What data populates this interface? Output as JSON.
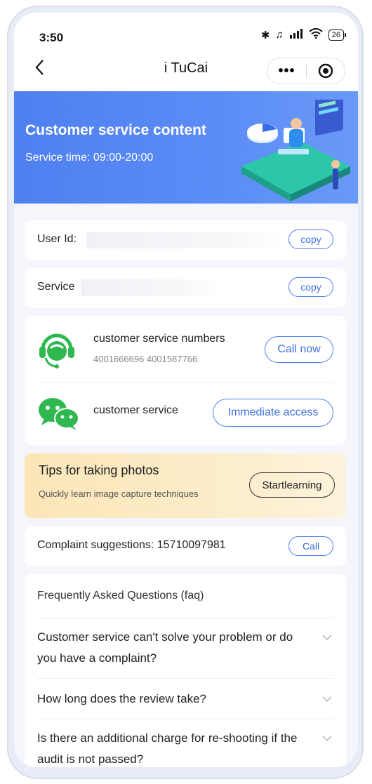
{
  "status": {
    "time": "3:50",
    "battery": "26"
  },
  "nav": {
    "title": "i TuCai",
    "more_glyph": "•••",
    "icons": [
      "back-chevron-icon",
      "more-dots-icon",
      "target-icon"
    ]
  },
  "banner": {
    "title": "Customer service content",
    "subtitle": "Service time: 09:00-20:00"
  },
  "user_row": {
    "label": "User Id:",
    "copy_label": "copy"
  },
  "service_row": {
    "label": "Service",
    "copy_label": "copy"
  },
  "contact": {
    "phone_title": "customer service numbers",
    "phone_numbers": "4001666696 4001587766",
    "call_now_label": "Call now",
    "wechat_title": "customer service",
    "access_label": "Immediate access"
  },
  "tips": {
    "title": "Tips for taking photos",
    "subtitle": "Quickly learn image capture techniques",
    "button_label": "Startlearning"
  },
  "complaint": {
    "label": "Complaint suggestions: 15710097981",
    "call_label": "Call"
  },
  "faq": {
    "heading": "Frequently Asked Questions (faq)",
    "items": [
      {
        "q": "Customer service can't solve your problem or do you have a complaint?"
      },
      {
        "q": "How long does the review take?"
      },
      {
        "q": "Is there an additional charge for re-shooting if the audit is not passed?"
      }
    ]
  },
  "colors": {
    "accent": "#4f80f0",
    "green_icon": "#2fb84f",
    "tips_bg": "#fbe6b8"
  }
}
